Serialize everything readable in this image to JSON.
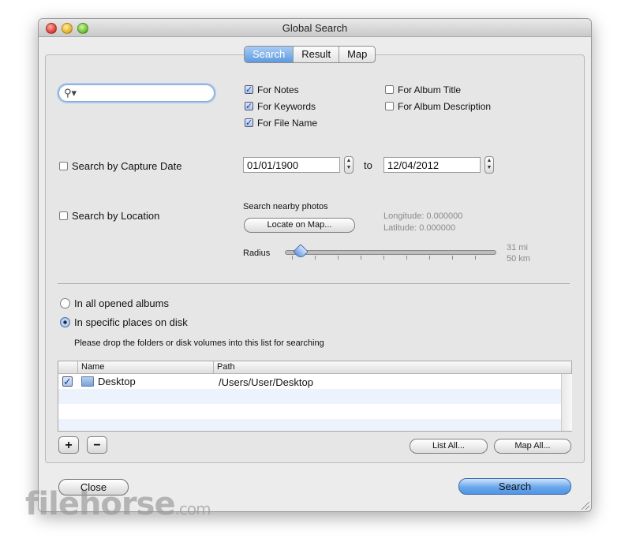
{
  "window": {
    "title": "Global Search"
  },
  "tabs": [
    {
      "label": "Search",
      "active": true
    },
    {
      "label": "Result",
      "active": false
    },
    {
      "label": "Map",
      "active": false
    }
  ],
  "search": {
    "value": "",
    "icon": "magnifier-icon"
  },
  "search_options": {
    "for_notes": {
      "label": "For Notes",
      "checked": true
    },
    "for_keywords": {
      "label": "For Keywords",
      "checked": true
    },
    "for_file_name": {
      "label": "For File Name",
      "checked": true
    },
    "for_album_title": {
      "label": "For Album Title",
      "checked": false
    },
    "for_album_description": {
      "label": "For Album Description",
      "checked": false
    }
  },
  "capture_date": {
    "label": "Search by Capture Date",
    "checked": false,
    "from": "01/01/1900",
    "to_label": "to",
    "to": "12/04/2012"
  },
  "location": {
    "label": "Search by Location",
    "checked": false,
    "nearby_label": "Search nearby photos",
    "locate_button": "Locate on Map...",
    "longitude": "Longitude: 0.000000",
    "latitude": "Latitude: 0.000000",
    "radius_label": "Radius",
    "radius_mi": "31 mi",
    "radius_km": "50 km",
    "radius_fraction": 0.07
  },
  "scope": {
    "all_albums": {
      "label": "In all opened albums",
      "selected": false
    },
    "specific_places": {
      "label": "In specific places on disk",
      "selected": true
    },
    "hint": "Please drop the folders or disk volumes into this list for searching"
  },
  "places_table": {
    "columns": [
      "Name",
      "Path"
    ],
    "rows": [
      {
        "checked": true,
        "name": "Desktop",
        "path": "/Users/User/Desktop"
      }
    ]
  },
  "list_buttons": {
    "add": "+",
    "remove": "−",
    "list_all": "List All...",
    "map_all": "Map All..."
  },
  "footer": {
    "close": "Close",
    "search": "Search"
  },
  "watermark": {
    "text": "filehorse",
    "suffix": ".com"
  },
  "colors": {
    "accent": "#5d9ae0",
    "window_bg": "#ececec"
  }
}
